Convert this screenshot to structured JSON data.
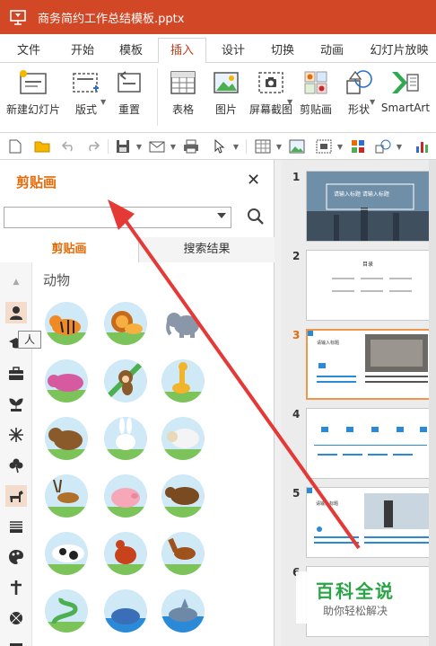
{
  "titlebar": {
    "title": "商务简约工作总结模板.pptx"
  },
  "menu_tabs": [
    "文件",
    "开始",
    "模板",
    "插入",
    "设计",
    "切换",
    "动画",
    "幻灯片放映"
  ],
  "ribbon": {
    "new_slide": "新建幻灯片",
    "layout": "版式",
    "reset": "重置",
    "table": "表格",
    "picture": "图片",
    "screenshot": "屏幕截图",
    "clipart": "剪贴画",
    "shapes": "形状",
    "smartart": "SmartArt"
  },
  "panel": {
    "title": "剪贴画",
    "tab_clipart": "剪贴画",
    "tab_results": "搜索结果",
    "group": "动物",
    "tooltip": "人"
  },
  "slides": {
    "numbers": [
      "1",
      "2",
      "3",
      "4",
      "5",
      "6"
    ],
    "s1_title": "请输入标题    请输入标题",
    "s2_title": "目录",
    "s3_title": "请输入标题",
    "s5_title": "请输入标题",
    "current": "3"
  },
  "watermark": {
    "big": "百科全说",
    "small": "助你轻松解决"
  },
  "colors": {
    "accent": "#d24726",
    "panel_accent": "#e46c0a"
  }
}
